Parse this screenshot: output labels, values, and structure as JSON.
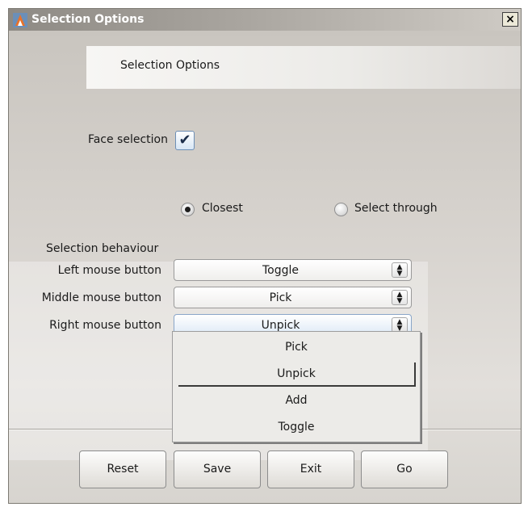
{
  "window": {
    "title": "Selection Options",
    "close_glyph": "×"
  },
  "header": {
    "title": "Selection Options"
  },
  "face_selection": {
    "label": "Face selection",
    "checked": true,
    "check_glyph": "✔"
  },
  "pick_mode": {
    "options": [
      {
        "label": "Closest",
        "selected": true
      },
      {
        "label": "Select through",
        "selected": false
      }
    ]
  },
  "behaviour": {
    "title": "Selection behaviour",
    "rows": [
      {
        "label": "Left mouse button",
        "value": "Toggle"
      },
      {
        "label": "Middle mouse button",
        "value": "Pick"
      },
      {
        "label": "Right mouse button",
        "value": "Unpick"
      }
    ],
    "dropdown_options": [
      "Pick",
      "Unpick",
      "Add",
      "Toggle"
    ],
    "dropdown_highlighted": "Unpick",
    "arrow_glyph": "▲▼"
  },
  "buttons": {
    "reset": "Reset",
    "save": "Save",
    "exit": "Exit",
    "go": "Go"
  },
  "colors": {
    "title_text": "#ffffff",
    "app_icon": "#e8722a",
    "window_bg": "#d4d0c8"
  },
  "icons": {
    "app": "app-icon",
    "close": "close-icon",
    "check": "check-icon",
    "dropdown": "chevron-updown-icon"
  }
}
